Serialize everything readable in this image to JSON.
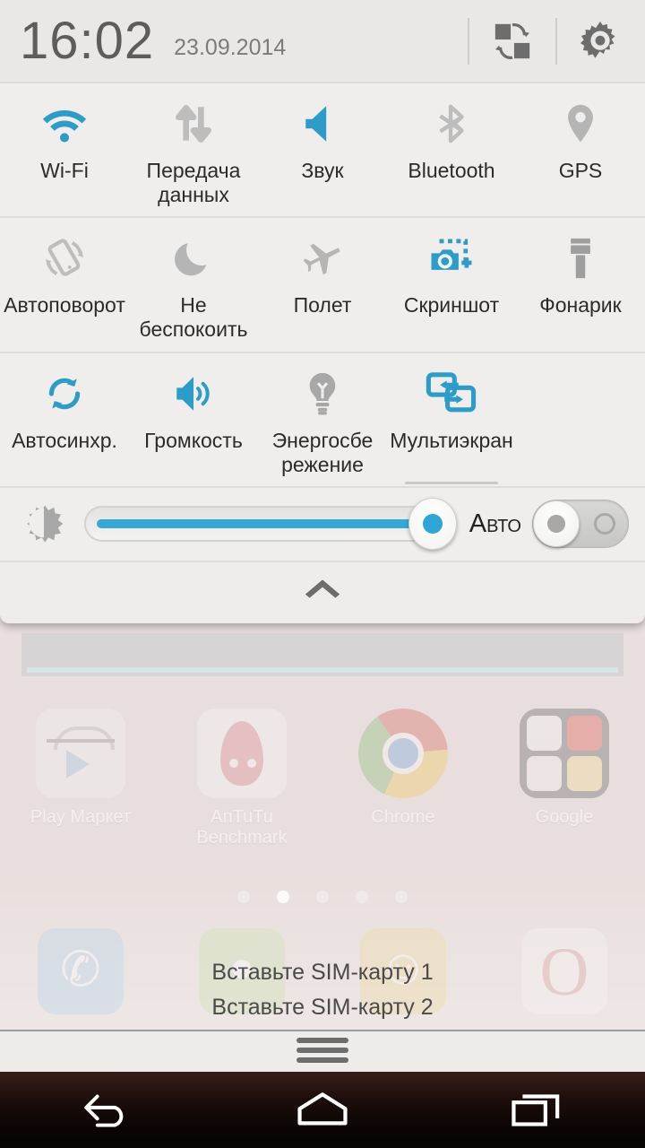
{
  "statusbar": {
    "time": "16:02",
    "date": "23.09.2014",
    "switch_user_icon": "switch-panel-icon",
    "settings_icon": "gear-icon"
  },
  "quick_settings": {
    "rows": [
      {
        "tiles": [
          {
            "label": "Wi-Fi",
            "icon": "wifi-icon",
            "active": true
          },
          {
            "label": "Передача данных",
            "icon": "data-transfer-icon",
            "active": false
          },
          {
            "label": "Звук",
            "icon": "sound-icon",
            "active": true
          },
          {
            "label": "Bluetooth",
            "icon": "bluetooth-icon",
            "active": false
          },
          {
            "label": "GPS",
            "icon": "gps-pin-icon",
            "active": false
          }
        ]
      },
      {
        "tiles": [
          {
            "label": "Автоповорот",
            "icon": "auto-rotate-icon",
            "active": false
          },
          {
            "label": "Не беспокоить",
            "icon": "moon-icon",
            "active": false
          },
          {
            "label": "Полет",
            "icon": "airplane-icon",
            "active": false
          },
          {
            "label": "Скриншот",
            "icon": "screenshot-camera-icon",
            "active": true
          },
          {
            "label": "Фонарик",
            "icon": "flashlight-icon",
            "active": false
          }
        ]
      },
      {
        "tiles": [
          {
            "label": "Автосинхр.",
            "icon": "auto-sync-icon",
            "active": true
          },
          {
            "label": "Громкость",
            "icon": "volume-icon",
            "active": true
          },
          {
            "label": "Энергосбе режение",
            "icon": "lightbulb-icon",
            "active": false
          },
          {
            "label": "Мультиэкран",
            "icon": "multiscreen-icon",
            "active": true,
            "underlined": true
          }
        ]
      }
    ]
  },
  "brightness": {
    "icon": "brightness-sun-icon",
    "value_percent": 97,
    "auto_label": "Авто",
    "auto_on": false
  },
  "collapse": {
    "icon": "chevron-up-icon"
  },
  "homescreen": {
    "apps": [
      {
        "label": "Play Маркет",
        "icon": "play-store-icon"
      },
      {
        "label": "AnTuTu Benchmark",
        "icon": "antutu-icon"
      },
      {
        "label": "Chrome",
        "icon": "chrome-icon"
      },
      {
        "label": "Google",
        "icon": "google-folder-icon"
      }
    ],
    "page_dots": {
      "count": 5,
      "active_index": 1
    },
    "sim_messages": [
      "Вставьте SIM-карту 1",
      "Вставьте SIM-карту 2"
    ],
    "dock": [
      {
        "icon": "phone-icon"
      },
      {
        "icon": "messages-icon"
      },
      {
        "icon": "contacts-icon"
      },
      {
        "icon": "opera-icon"
      }
    ],
    "app_drawer_handle": "app-drawer-handle-icon"
  },
  "navbar": {
    "back_icon": "back-icon",
    "home_icon": "home-icon",
    "recents_icon": "recents-icon"
  },
  "colors": {
    "accent_blue": "#2fa4d6",
    "inactive_gray": "#b3b3b3",
    "panel_bg": "#edecea",
    "text_dark": "#2b2b2b"
  }
}
